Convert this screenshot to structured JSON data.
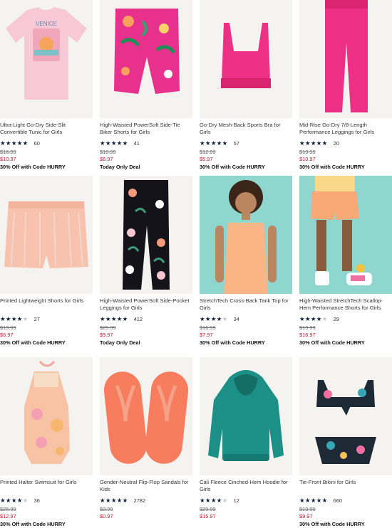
{
  "products": [
    {
      "title": "Ultra-Light Go-Dry Side-Slit Convertible Tunic for Girls",
      "stars": 5,
      "reviews": "60",
      "was": "$16.99",
      "now": "$10.97",
      "promo": "30% Off with Code HURRY",
      "image": "pink-tunic-tee",
      "image_text": "VENICE"
    },
    {
      "title": "High-Waisted PowerSoft Side-Tie Biker Shorts for Girls",
      "stars": 5,
      "reviews": "41",
      "was": "$19.99",
      "now": "$6.97",
      "promo": "Today Only Deal",
      "image": "tropical-biker-shorts"
    },
    {
      "title": "Go-Dry Mesh-Back Sports Bra for Girls",
      "stars": 5,
      "reviews": "57",
      "was": "$12.99",
      "now": "$5.97",
      "promo": "30% Off with Code HURRY",
      "image": "pink-sports-bra"
    },
    {
      "title": "Mid-Rise Go-Dry 7/8-Length Performance Leggings for Girls",
      "stars": 5,
      "reviews": "20",
      "was": "$19.99",
      "now": "$10.97",
      "promo": "30% Off with Code HURRY",
      "image": "pink-leggings"
    },
    {
      "title": "Printed Lightweight Shorts for Girls",
      "stars": 4,
      "reviews": "27",
      "was": "$19.99",
      "now": "$6.97",
      "promo": "30% Off with Code HURRY",
      "image": "peach-shorts"
    },
    {
      "title": "High-Waisted PowerSoft Side-Pocket Leggings for Girls",
      "stars": 5,
      "reviews": "412",
      "was": "$29.99",
      "now": "$9.97",
      "promo": "Today Only Deal",
      "image": "floral-leggings"
    },
    {
      "title": "StretchTech Cross-Back Tank Top for Girls",
      "stars": 4,
      "reviews": "34",
      "was": "$16.99",
      "now": "$7.97",
      "promo": "30% Off with Code HURRY",
      "image": "girl-in-orange-tank"
    },
    {
      "title": "High-Waisted StretchTech Scallop-Hem Performance Shorts for Girls",
      "stars": 4.5,
      "reviews": "29",
      "was": "$19.99",
      "now": "$16.97",
      "promo": "30% Off with Code HURRY",
      "image": "girl-in-scallop-shorts"
    },
    {
      "title": "Printed Halter Swimsuit for Girls",
      "stars": 4.5,
      "reviews": "36",
      "was": "$26.99",
      "now": "$12.97",
      "promo": "30% Off with Code HURRY",
      "image": "halter-swimsuit"
    },
    {
      "title": "Gender-Neutral Flip-Flop Sandals for Kids",
      "stars": 5,
      "reviews": "2782",
      "was": "$3.99",
      "now": "$0.97",
      "promo": "",
      "image": "coral-flip-flops"
    },
    {
      "title": "Cali Fleece Cinched-Hem Hoodie for Girls",
      "stars": 4.5,
      "reviews": "12",
      "was": "$29.99",
      "now": "$15.97",
      "promo": "",
      "image": "teal-hoodie"
    },
    {
      "title": "Tie-Front Bikini for Girls",
      "stars": 5,
      "reviews": "660",
      "was": "$19.99",
      "now": "$9.97",
      "promo": "30% Off with Code HURRY",
      "image": "tropical-bikini"
    }
  ],
  "colors": {
    "star": "#0b1f3a",
    "sale": "#c8102e",
    "bg": "#f4f3f1"
  }
}
